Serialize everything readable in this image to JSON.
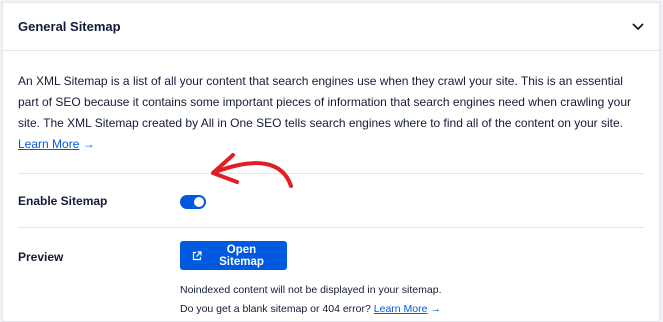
{
  "panel": {
    "title": "General Sitemap"
  },
  "description": {
    "text": "An XML Sitemap is a list of all your content that search engines use when they crawl your site. This is an essential part of SEO because it contains some important pieces of information that search engines need when crawling your site. The XML Sitemap created by All in One SEO tells search engines where to find all of the content on your site.",
    "link_label": "Learn More",
    "link_arrow": "→"
  },
  "enable_sitemap": {
    "label": "Enable Sitemap",
    "enabled": true
  },
  "preview": {
    "label": "Preview",
    "button_label": "Open Sitemap",
    "note1": "Noindexed content will not be displayed in your sitemap.",
    "note2": "Do you get a blank sitemap or 404 error?",
    "note2_link": "Learn More",
    "note2_arrow": "→"
  },
  "colors": {
    "accent": "#005ae0",
    "text": "#141b38",
    "annotation_arrow": "#e41c24",
    "border": "#e3e5ea"
  },
  "icons": {
    "collapse": "chevron-down-icon",
    "external": "external-link-icon",
    "annotation": "hand-drawn-arrow"
  }
}
